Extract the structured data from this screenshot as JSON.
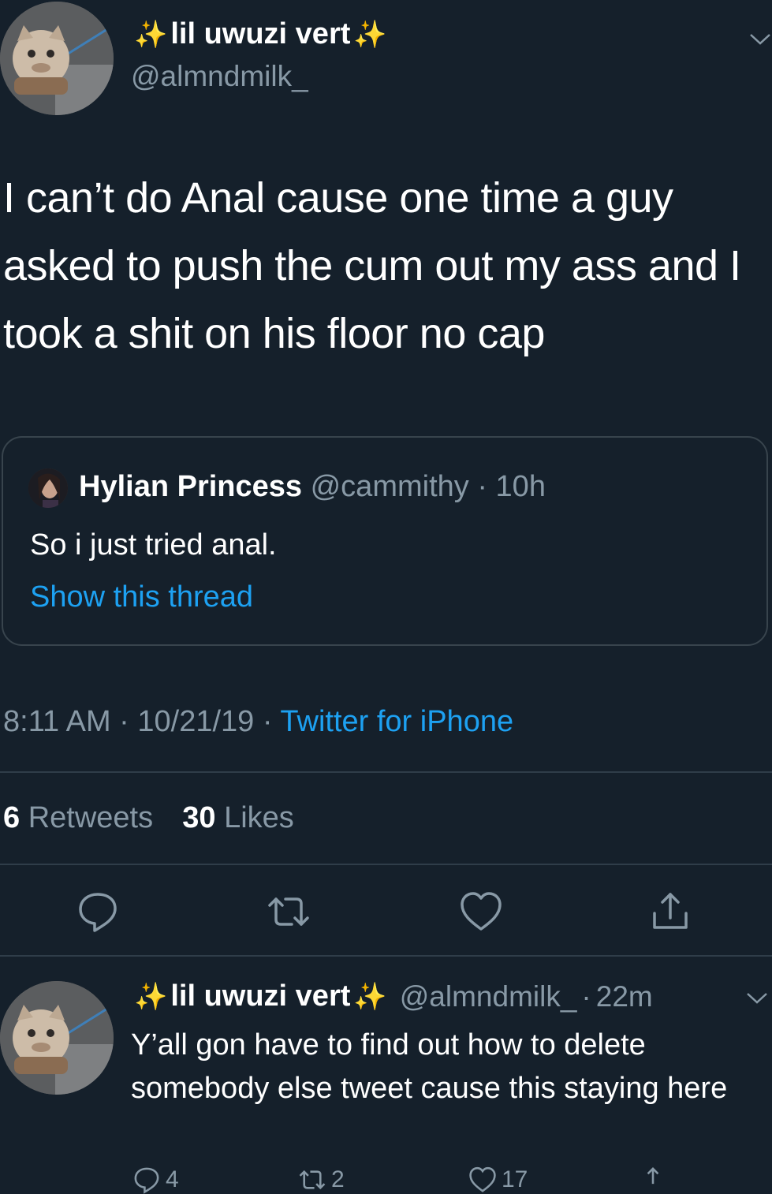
{
  "main_tweet": {
    "display_name": "lil uwuzi vert",
    "sparkle_left": "✨",
    "sparkle_right": "✨",
    "handle": "@almndmilk_",
    "text": "I can’t do Anal cause one time a guy asked to push the cum out my ass and I took a shit on his floor no cap",
    "quoted": {
      "display_name": "Hylian Princess",
      "handle": "@cammithy",
      "separator": "·",
      "age": "10h",
      "text": "So i just tried anal.",
      "show_thread": "Show this thread"
    },
    "time": "8:11 AM",
    "date": "10/21/19",
    "dot": "·",
    "source": "Twitter for iPhone",
    "retweets_count": "6",
    "retweets_label": "Retweets",
    "likes_count": "30",
    "likes_label": "Likes",
    "actions": {
      "reply_icon": "reply-icon",
      "retweet_icon": "retweet-icon",
      "like_icon": "heart-icon",
      "share_icon": "share-icon"
    }
  },
  "reply_tweet": {
    "display_name": "lil uwuzi vert",
    "sparkle_left": "✨",
    "sparkle_right": "✨",
    "handle": "@almndmilk_",
    "separator": "·",
    "age": "22m",
    "text": "Y’all gon have to find out how to delete somebody else tweet cause this staying here",
    "reply_count": "4",
    "retweet_count": "2",
    "like_count": "17"
  },
  "colors": {
    "background": "#15202b",
    "text_primary": "#ffffff",
    "text_secondary": "#8899a6",
    "link": "#1da1f2",
    "border": "#38444d",
    "sparkle": "#f5c33b"
  }
}
